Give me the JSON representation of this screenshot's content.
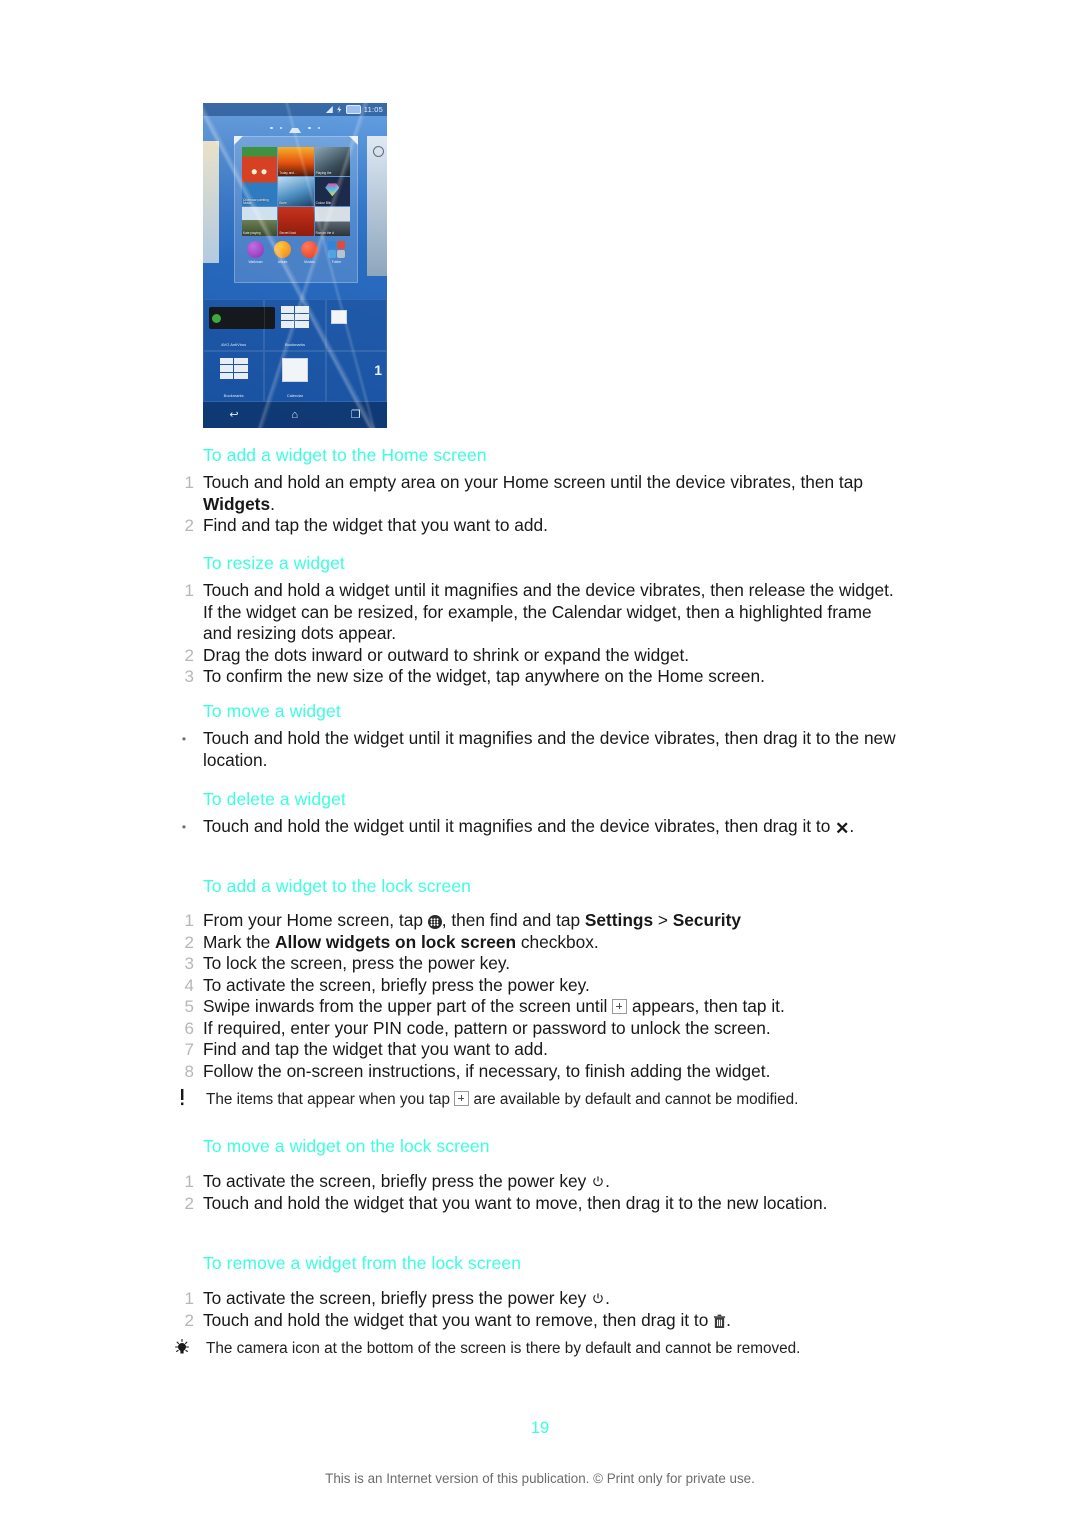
{
  "document": {
    "page_number": "19",
    "footer": "This is an Internet version of this publication. © Print only for private use.",
    "heading_color": "#3CFFE0"
  },
  "figure": {
    "name": "home-screen-widget-picker-screenshot",
    "status_bar": {
      "time": "11:05"
    },
    "widget_tiles": [
      {
        "label": "Cruel war painting Music"
      },
      {
        "label": "Today and..."
      },
      {
        "label": "Playing the"
      },
      {
        "label": "Bone"
      },
      {
        "label": "Colour Blin"
      },
      {
        "label": "Kate playing"
      },
      {
        "label": "Secret Noct"
      },
      {
        "label": "Ran on the d"
      },
      {
        "label": "wallsbound"
      }
    ],
    "apps": [
      {
        "label": "Walkman"
      },
      {
        "label": "Album"
      },
      {
        "label": "Movies"
      },
      {
        "label": "Folder"
      }
    ],
    "list_widgets": [
      {
        "label": "AVG AntiVirus"
      },
      {
        "label": "Bookmarks"
      },
      {
        "label": "Bookmarks"
      },
      {
        "label": "Calendar"
      }
    ],
    "big_number": "1",
    "nav": [
      {
        "name": "back-button",
        "glyph": "↩"
      },
      {
        "name": "home-button",
        "glyph": "⌂"
      },
      {
        "name": "recents-button",
        "glyph": "❐"
      }
    ]
  },
  "sections": [
    {
      "id": "add-widget-home",
      "heading": "To add a widget to the Home screen",
      "list_type": "ordered",
      "items": [
        {
          "number": "1",
          "html": "Touch and hold an empty area on your Home screen until the device vibrates, then tap <b>Widgets</b>."
        },
        {
          "number": "2",
          "html": "Find and tap the widget that you want to add."
        }
      ]
    },
    {
      "id": "resize-widget",
      "heading": "To resize a widget",
      "list_type": "ordered",
      "items": [
        {
          "number": "1",
          "html": "Touch and hold a widget until it magnifies and the device vibrates, then release the widget. If the widget can be resized, for example, the Calendar widget, then a highlighted frame and resizing dots appear."
        },
        {
          "number": "2",
          "html": "Drag the dots inward or outward to shrink or expand the widget."
        },
        {
          "number": "3",
          "html": "To confirm the new size of the widget, tap anywhere on the Home screen."
        }
      ]
    },
    {
      "id": "move-widget",
      "heading": "To move a widget",
      "list_type": "bulleted",
      "items": [
        {
          "number": "•",
          "html": "Touch and hold the widget until it magnifies and the device vibrates, then drag it to the new location."
        }
      ]
    },
    {
      "id": "delete-widget",
      "heading": "To delete a widget",
      "list_type": "bulleted",
      "items": [
        {
          "number": "•",
          "html": "Touch and hold the widget until it magnifies and the device vibrates, then drag it to <span class=\"ig ig-x\" data-name=\"close-x-icon\">✕</span>."
        }
      ]
    },
    {
      "id": "add-widget-lock",
      "heading": "To add a widget to the lock screen",
      "list_type": "ordered",
      "items": [
        {
          "number": "1",
          "html": "From your Home screen, tap <span class=\"ig ig-apps\" data-name=\"app-drawer-icon\"></span>, then find and tap <b>Settings</b> &gt; <b>Security</b>"
        },
        {
          "number": "2",
          "html": "Mark the <b>Allow widgets on lock screen</b> checkbox."
        },
        {
          "number": "3",
          "html": "To lock the screen, press the power key."
        },
        {
          "number": "4",
          "html": "To activate the screen, briefly press the power key."
        },
        {
          "number": "5",
          "html": "Swipe inwards from the upper part of the screen until <span class=\"ig ig-plus\" data-name=\"plus-icon\"></span> appears, then tap it."
        },
        {
          "number": "6",
          "html": "If required, enter your PIN code, pattern or password to unlock the screen."
        },
        {
          "number": "7",
          "html": "Find and tap the widget that you want to add."
        },
        {
          "number": "8",
          "html": "Follow the on-screen instructions, if necessary, to finish adding the widget."
        }
      ]
    },
    {
      "id": "move-widget-lock",
      "heading": "To move a widget on the lock screen",
      "list_type": "ordered",
      "items": [
        {
          "number": "1",
          "html": "To activate the screen, briefly press the power key <span class=\"ig ig-power\" data-name=\"power-icon\"><svg viewBox=\"0 0 20 20\" width=\"14\" height=\"14\"><path d=\"M10 2.5 v6\" stroke=\"#222\" stroke-width=\"1.6\" fill=\"none\" stroke-linecap=\"round\"/><path d=\"M5.6 5.1 a6 6 0 1 0 8.8 0\" stroke=\"#222\" stroke-width=\"1.6\" fill=\"none\" stroke-linecap=\"round\"/></svg></span>."
        },
        {
          "number": "2",
          "html": "Touch and hold the widget that you want to move, then drag it to the new location."
        }
      ]
    },
    {
      "id": "remove-widget-lock",
      "heading": "To remove a widget from the lock screen",
      "list_type": "ordered",
      "items": [
        {
          "number": "1",
          "html": "To activate the screen, briefly press the power key <span class=\"ig ig-power\" data-name=\"power-icon\"><svg viewBox=\"0 0 20 20\" width=\"14\" height=\"14\"><path d=\"M10 2.5 v6\" stroke=\"#222\" stroke-width=\"1.6\" fill=\"none\" stroke-linecap=\"round\"/><path d=\"M5.6 5.1 a6 6 0 1 0 8.8 0\" stroke=\"#222\" stroke-width=\"1.6\" fill=\"none\" stroke-linecap=\"round\"/></svg></span>."
        },
        {
          "number": "2",
          "html": "Touch and hold the widget that you want to remove, then drag it to <span class=\"ig ig-trash\" data-name=\"trash-icon\"><svg viewBox=\"0 0 14 16\" width=\"13\" height=\"15\"><rect x=\"2\" y=\"4\" width=\"10\" height=\"11\" fill=\"#3a3a3a\"/><rect x=\"1\" y=\"2.4\" width=\"12\" height=\"1.6\" fill=\"#3a3a3a\"/><rect x=\"5\" y=\"0.6\" width=\"4\" height=\"1.6\" fill=\"#3a3a3a\"/><rect x=\"4.3\" y=\"6\" width=\"1.2\" height=\"7\" fill=\"#fff\"/><rect x=\"6.4\" y=\"6\" width=\"1.2\" height=\"7\" fill=\"#fff\"/><rect x=\"8.5\" y=\"6\" width=\"1.2\" height=\"7\" fill=\"#fff\"/></svg></span>."
        }
      ]
    }
  ],
  "notes": [
    {
      "id": "note-default-items",
      "icon": "exclamation-icon",
      "html": "The items that appear when you tap <span class=\"ig ig-plus\" data-name=\"plus-icon\"></span> are available by default and cannot be modified."
    },
    {
      "id": "note-camera-icon",
      "icon": "lightbulb-icon",
      "html": "The camera icon at the bottom of the screen is there by default and cannot be removed."
    }
  ]
}
